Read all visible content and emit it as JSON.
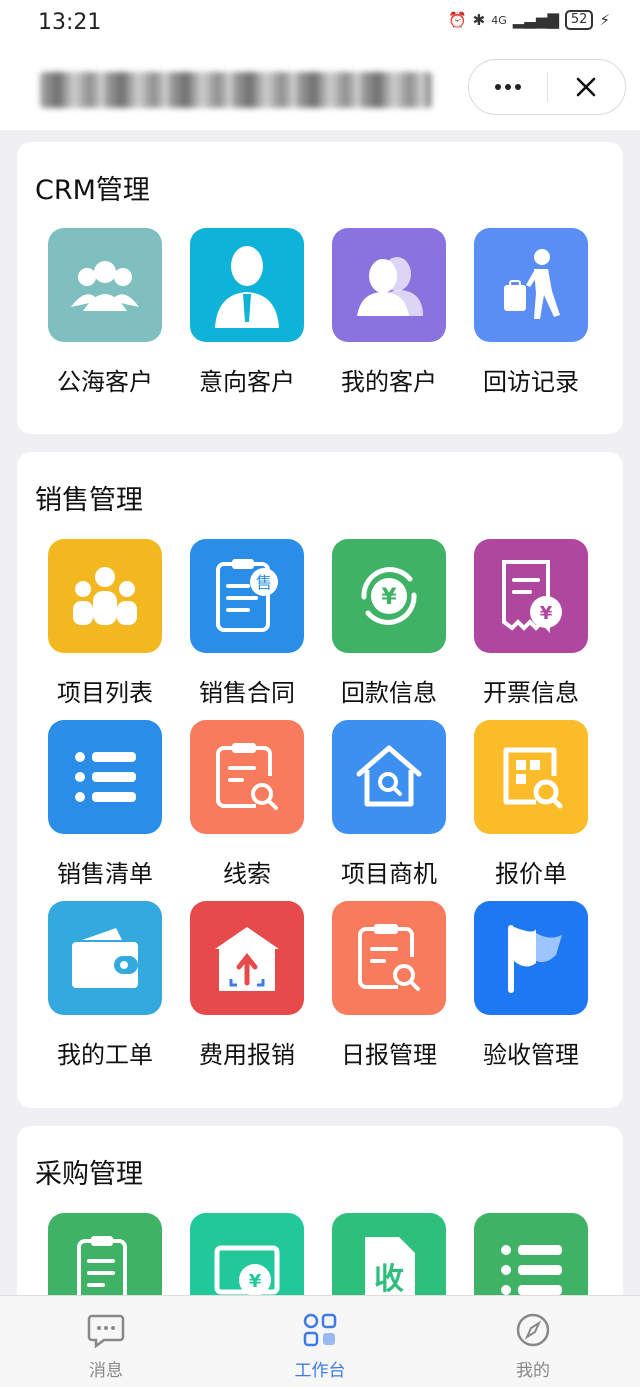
{
  "status_bar": {
    "time": "13:21",
    "network": "4G",
    "battery": "52"
  },
  "colors": {
    "active_tab": "#3e7be9"
  },
  "sections": [
    {
      "title": "CRM管理",
      "items": [
        {
          "label": "公海客户",
          "icon": "group-icon",
          "color": "#7fbfbf"
        },
        {
          "label": "意向客户",
          "icon": "businessman-icon",
          "color": "#10b3d8"
        },
        {
          "label": "我的客户",
          "icon": "users-icon",
          "color": "#8b73df"
        },
        {
          "label": "回访记录",
          "icon": "walking-traveler-icon",
          "color": "#5b8ef5"
        }
      ]
    },
    {
      "title": "销售管理",
      "items": [
        {
          "label": "项目列表",
          "icon": "team-icon",
          "color": "#f3b820"
        },
        {
          "label": "销售合同",
          "icon": "contract-clipboard-icon",
          "color": "#2a8ee8"
        },
        {
          "label": "回款信息",
          "icon": "yuan-refresh-icon",
          "color": "#3fb266"
        },
        {
          "label": "开票信息",
          "icon": "invoice-icon",
          "color": "#b0479e"
        },
        {
          "label": "销售清单",
          "icon": "list-icon",
          "color": "#2a8ee8"
        },
        {
          "label": "线索",
          "icon": "clipboard-search-icon",
          "color": "#f87b5d"
        },
        {
          "label": "项目商机",
          "icon": "house-search-icon",
          "color": "#3d8ff0"
        },
        {
          "label": "报价单",
          "icon": "grid-search-icon",
          "color": "#fbbc2a"
        },
        {
          "label": "我的工单",
          "icon": "wallet-icon",
          "color": "#34a9dd"
        },
        {
          "label": "费用报销",
          "icon": "upload-box-icon",
          "color": "#e64a4a"
        },
        {
          "label": "日报管理",
          "icon": "clipboard-search-icon",
          "color": "#f87b5d"
        },
        {
          "label": "验收管理",
          "icon": "flag-icon",
          "color": "#1e78f2"
        }
      ]
    },
    {
      "title": "采购管理",
      "items": [
        {
          "label": "",
          "icon": "purchase-clipboard-icon",
          "color": "#3fb266"
        },
        {
          "label": "",
          "icon": "yuan-card-icon",
          "color": "#22c89a"
        },
        {
          "label": "",
          "icon": "receive-doc-icon",
          "color": "#2fbf7d"
        },
        {
          "label": "",
          "icon": "list-icon",
          "color": "#3fb266"
        }
      ]
    }
  ],
  "tabs": [
    {
      "label": "消息",
      "icon": "chat-icon",
      "active": false
    },
    {
      "label": "工作台",
      "icon": "workbench-icon",
      "active": true
    },
    {
      "label": "我的",
      "icon": "compass-icon",
      "active": false
    }
  ]
}
